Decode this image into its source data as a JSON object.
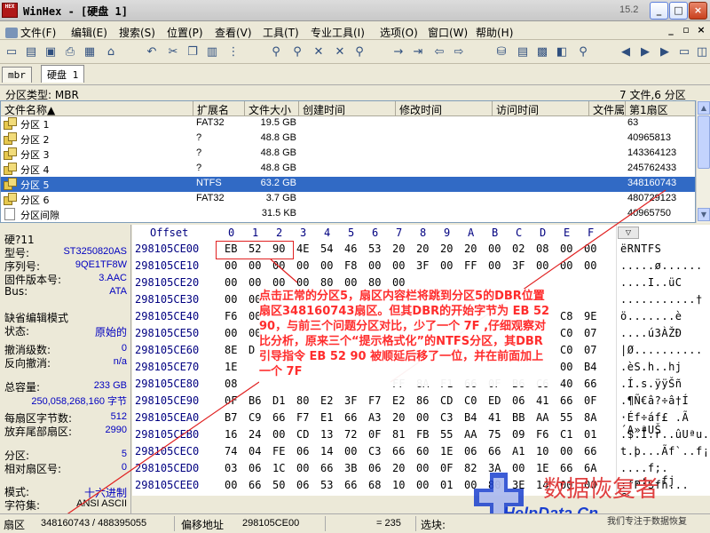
{
  "window": {
    "app_badge": "HEX",
    "title": "WinHex - [硬盘 1]",
    "version": "15.2",
    "buttons": [
      "_",
      "□",
      "×"
    ]
  },
  "menu": [
    {
      "label": "文件(F)"
    },
    {
      "label": "编辑(E)"
    },
    {
      "label": "搜索(S)"
    },
    {
      "label": "位置(P)"
    },
    {
      "label": "查看(V)"
    },
    {
      "label": "工具(T)"
    },
    {
      "label": "专业工具(I)"
    },
    {
      "label": "选项(O)"
    },
    {
      "label": "窗口(W)"
    },
    {
      "label": "帮助(H)"
    }
  ],
  "tabs": [
    "mbr",
    "硬盘 1"
  ],
  "partition_info": {
    "type_label": "分区类型: MBR",
    "summary": "7 文件,6 分区"
  },
  "file_list": {
    "columns": [
      "文件名称▲",
      "扩展名",
      "文件大小",
      "创建时间",
      "修改时间",
      "访问时间",
      "文件属性",
      "第1扇区"
    ],
    "rows": [
      {
        "name": "分区 1",
        "ext": "FAT32",
        "size": "19.5 GB",
        "sector": "63"
      },
      {
        "name": "分区 2",
        "ext": "?",
        "size": "48.8 GB",
        "sector": "40965813"
      },
      {
        "name": "分区 3",
        "ext": "?",
        "size": "48.8 GB",
        "sector": "143364123"
      },
      {
        "name": "分区 4",
        "ext": "?",
        "size": "48.8 GB",
        "sector": "245762433"
      },
      {
        "name": "分区 5",
        "ext": "NTFS",
        "size": "63.2 GB",
        "sector": "348160743",
        "selected": true
      },
      {
        "name": "分区 6",
        "ext": "FAT32",
        "size": "3.7 GB",
        "sector": "480729123"
      },
      {
        "name": "分区间隙",
        "ext": "",
        "size": "31.5 KB",
        "sector": "40965750",
        "gap": true
      }
    ]
  },
  "info_panel": {
    "disk_label": "硬?11",
    "model_label": "型号:",
    "model": "ST3250820AS",
    "serial_label": "序列号:",
    "serial": "9QE1TF8W",
    "firmware_label": "固件版本号:",
    "firmware": "3.AAC",
    "bus_label": "Bus:",
    "bus": "ATA",
    "edit_mode_label": "缺省编辑模式",
    "state_label": "状态:",
    "state": "原始的",
    "undo_level_label": "撤消级数:",
    "undo_level": "0",
    "undo_reverse_label": "反向撤消:",
    "undo_reverse": "n/a",
    "capacity_label": "总容量:",
    "capacity_gb": "233 GB",
    "capacity_bytes": "250,058,268,160 字节",
    "bytes_per_sector_label": "每扇区字节数:",
    "bytes_per_sector": "512",
    "tail_sectors_label": "放弃尾部扇区:",
    "tail_sectors": "2990",
    "partition_label": "分区:",
    "partition": "5",
    "rel_sector_label": "相对扇区号:",
    "rel_sector": "0",
    "mode_label": "模式:",
    "mode": "十六进制",
    "charset_label": "字符集:",
    "charset": "ANSI ASCII"
  },
  "hex_view": {
    "offset_header": "Offset",
    "col_headers": [
      "0",
      "1",
      "2",
      "3",
      "4",
      "5",
      "6",
      "7",
      "8",
      "9",
      "A",
      "B",
      "C",
      "D",
      "E",
      "F"
    ],
    "lines": [
      {
        "off": "298105CE00",
        "bytes": [
          "EB",
          "52",
          "90",
          "4E",
          "54",
          "46",
          "53",
          "20",
          "20",
          "20",
          "20",
          "00",
          "02",
          "08",
          "00",
          "00"
        ],
        "ascii": "ëRNTFS"
      },
      {
        "off": "298105CE10",
        "bytes": [
          "00",
          "00",
          "00",
          "00",
          "00",
          "F8",
          "00",
          "00",
          "3F",
          "00",
          "FF",
          "00",
          "3F",
          "00",
          "00",
          "00"
        ],
        "ascii": ".....ø......"
      },
      {
        "off": "298105CE20",
        "bytes": [
          "00",
          "00",
          "00",
          "00",
          "80",
          "00",
          "80",
          "00",
          "",
          "",
          "",
          "",
          "",
          "",
          "",
          ""
        ],
        "ascii": "....I..üC"
      },
      {
        "off": "298105CE30",
        "bytes": [
          "00",
          "00",
          "",
          "",
          "",
          "",
          "",
          "",
          "",
          "",
          "",
          "",
          "",
          "",
          "",
          ""
        ],
        "ascii": "...........†"
      },
      {
        "off": "298105CE40",
        "bytes": [
          "F6",
          "00",
          "",
          "",
          "",
          "",
          "",
          "",
          "",
          "",
          "",
          "",
          "",
          "",
          "C8",
          "9E"
        ],
        "ascii": "ö.......è"
      },
      {
        "off": "298105CE50",
        "bytes": [
          "00",
          "00",
          "",
          "",
          "",
          "",
          "",
          "",
          "",
          "",
          "",
          "",
          "",
          "",
          "C0",
          "07"
        ],
        "ascii": "....ú3ÀŽÐ"
      },
      {
        "off": "298105CE60",
        "bytes": [
          "8E",
          "D",
          "",
          "",
          "",
          "",
          "",
          "",
          "",
          "",
          "",
          "",
          "",
          "",
          "C0",
          "07"
        ],
        "ascii": "|Ø.........."
      },
      {
        "off": "298105CE70",
        "bytes": [
          "1E",
          "",
          "",
          "",
          "",
          "",
          "",
          "",
          "",
          "",
          "",
          "",
          "",
          "",
          "00",
          "B4"
        ],
        "ascii": ".èS.h..hj"
      },
      {
        "off": "298105CE80",
        "bytes": [
          "08",
          "",
          "",
          "",
          "",
          "",
          "",
          "FF",
          "8A",
          "F1",
          "66",
          "0F",
          "B6",
          "C6",
          "40",
          "66"
        ],
        "ascii": ".Í.s.ÿÿŠñ"
      },
      {
        "off": "298105CE90",
        "bytes": [
          "0F",
          "B6",
          "D1",
          "80",
          "E2",
          "3F",
          "F7",
          "E2",
          "86",
          "CD",
          "C0",
          "ED",
          "06",
          "41",
          "66",
          "0F"
        ],
        "ascii": ".¶Ñ€â?÷â†Í"
      },
      {
        "off": "298105CEA0",
        "bytes": [
          "B7",
          "C9",
          "66",
          "F7",
          "E1",
          "66",
          "A3",
          "20",
          "00",
          "C3",
          "B4",
          "41",
          "BB",
          "AA",
          "55",
          "8A"
        ],
        "ascii": "·Éf÷áf£ .Ã´A»ªUŠ"
      },
      {
        "off": "298105CEB0",
        "bytes": [
          "16",
          "24",
          "00",
          "CD",
          "13",
          "72",
          "0F",
          "81",
          "FB",
          "55",
          "AA",
          "75",
          "09",
          "F6",
          "C1",
          "01"
        ],
        "ascii": ".$.Í.r..ûUªu.öÁ."
      },
      {
        "off": "298105CEC0",
        "bytes": [
          "74",
          "04",
          "FE",
          "06",
          "14",
          "00",
          "C3",
          "66",
          "60",
          "1E",
          "06",
          "66",
          "A1",
          "10",
          "00",
          "66"
        ],
        "ascii": "t.þ...Ãf`..f¡..f"
      },
      {
        "off": "298105CED0",
        "bytes": [
          "03",
          "06",
          "1C",
          "00",
          "66",
          "3B",
          "06",
          "20",
          "00",
          "0F",
          "82",
          "3A",
          "00",
          "1E",
          "66",
          "6A"
        ],
        "ascii": "....f;. ...:..fj"
      },
      {
        "off": "298105CEE0",
        "bytes": [
          "00",
          "66",
          "50",
          "06",
          "53",
          "66",
          "68",
          "10",
          "00",
          "01",
          "00",
          "80",
          "3E",
          "14",
          "00",
          "00"
        ],
        "ascii": ".fP.Sfh...€>.."
      }
    ]
  },
  "annotation": "点击正常的分区5，扇区内容栏将跳到分区5的DBR位置扇区348160743扇区。但其DBR的开始字节为 EB 52 90，与前三个问题分区对比，少了一个 7F ,仔细观察对比分析，原来三个“提示格式化”的NTFS分区，其DBR引导指令 EB 52 90 被顺延后移了一位，并在前面加上一个 7F",
  "watermark": {
    "brand": "数据恢复者",
    "url": "HelpData.Cn",
    "slogan": "我们专注于数据恢复"
  },
  "status": {
    "sector_label": "扇区",
    "sector_value": "348160743",
    "sector_total": "/ 488395055",
    "offset_label": "偏移地址",
    "offset_value": "298105CE00",
    "value": "= 235",
    "block_label": "选块:"
  },
  "colors": {
    "selection": "#316ac5",
    "annotation_red": "#ff2020",
    "hex_offset": "#000080",
    "value_blue": "#0000c0"
  }
}
